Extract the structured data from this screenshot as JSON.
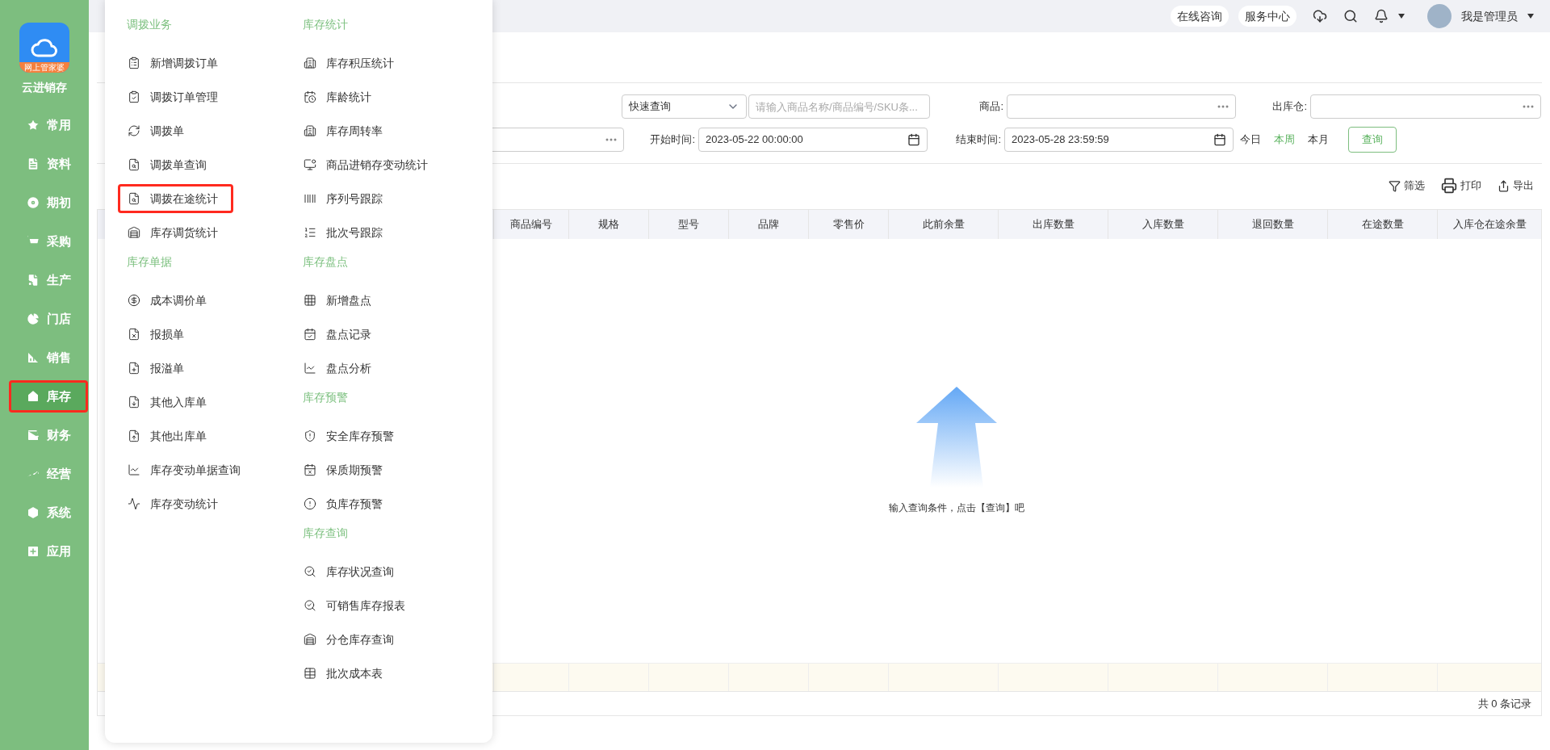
{
  "app": {
    "name": "云进销存",
    "logo_badge": "网上管家婆"
  },
  "sidebar": {
    "items": [
      {
        "label": "常用",
        "selected": false
      },
      {
        "label": "资料",
        "selected": false
      },
      {
        "label": "期初",
        "selected": false
      },
      {
        "label": "采购",
        "selected": false
      },
      {
        "label": "生产",
        "selected": false
      },
      {
        "label": "门店",
        "selected": false
      },
      {
        "label": "销售",
        "selected": false
      },
      {
        "label": "库存",
        "selected": true
      },
      {
        "label": "财务",
        "selected": false
      },
      {
        "label": "经营",
        "selected": false
      },
      {
        "label": "系统",
        "selected": false
      },
      {
        "label": "应用",
        "selected": false
      }
    ]
  },
  "header": {
    "buttons": [
      "在线咨询",
      "服务中心"
    ],
    "user": "我是管理员"
  },
  "menu": {
    "columns": [
      [
        {
          "title": "调拨业务",
          "items": [
            {
              "label": "新增调拨订单",
              "highlighted": false
            },
            {
              "label": "调拨订单管理",
              "highlighted": false
            },
            {
              "label": "调拨单",
              "highlighted": false
            },
            {
              "label": "调拨单查询",
              "highlighted": false
            },
            {
              "label": "调拨在途统计",
              "highlighted": true
            },
            {
              "label": "库存调货统计",
              "highlighted": false
            }
          ]
        },
        {
          "title": "库存单据",
          "items": [
            {
              "label": "成本调价单",
              "highlighted": false
            },
            {
              "label": "报损单",
              "highlighted": false
            },
            {
              "label": "报溢单",
              "highlighted": false
            },
            {
              "label": "其他入库单",
              "highlighted": false
            },
            {
              "label": "其他出库单",
              "highlighted": false
            },
            {
              "label": "库存变动单据查询",
              "highlighted": false
            },
            {
              "label": "库存变动统计",
              "highlighted": false
            }
          ]
        }
      ],
      [
        {
          "title": "库存统计",
          "items": [
            {
              "label": "库存积压统计",
              "highlighted": false
            },
            {
              "label": "库龄统计",
              "highlighted": false
            },
            {
              "label": "库存周转率",
              "highlighted": false
            },
            {
              "label": "商品进销存变动统计",
              "highlighted": false
            },
            {
              "label": "序列号跟踪",
              "highlighted": false
            },
            {
              "label": "批次号跟踪",
              "highlighted": false
            }
          ]
        },
        {
          "title": "库存盘点",
          "items": [
            {
              "label": "新增盘点",
              "highlighted": false
            },
            {
              "label": "盘点记录",
              "highlighted": false
            },
            {
              "label": "盘点分析",
              "highlighted": false
            }
          ]
        },
        {
          "title": "库存预警",
          "items": [
            {
              "label": "安全库存预警",
              "highlighted": false
            },
            {
              "label": "保质期预警",
              "highlighted": false
            },
            {
              "label": "负库存预警",
              "highlighted": false
            }
          ]
        },
        {
          "title": "库存查询",
          "items": [
            {
              "label": "库存状况查询",
              "highlighted": false
            },
            {
              "label": "可销售库存报表",
              "highlighted": false
            },
            {
              "label": "分仓库存查询",
              "highlighted": false
            },
            {
              "label": "批次成本表",
              "highlighted": false
            }
          ]
        }
      ]
    ]
  },
  "filters": {
    "quick_select": "快速查询",
    "quick_placeholder": "请输入商品名称/商品编号/SKU条...",
    "product_label": "商品:",
    "warehouse_label": "出库仓:",
    "start_label": "开始时间:",
    "start_value": "2023-05-22 00:00:00",
    "end_label": "结束时间:",
    "end_value": "2023-05-28 23:59:59",
    "ranges": [
      {
        "label": "今日",
        "selected": false
      },
      {
        "label": "本周",
        "selected": true
      },
      {
        "label": "本月",
        "selected": false
      }
    ],
    "query_button": "查询"
  },
  "toolbar": [
    "筛选",
    "打印",
    "导出"
  ],
  "table": {
    "columns": [
      "商品编号",
      "规格",
      "型号",
      "品牌",
      "零售价",
      "此前余量",
      "出库数量",
      "入库数量",
      "退回数量",
      "在途数量",
      "入库仓在途余量"
    ],
    "empty_text": "输入查询条件，点击【查询】吧",
    "total": "共 0 条记录"
  }
}
